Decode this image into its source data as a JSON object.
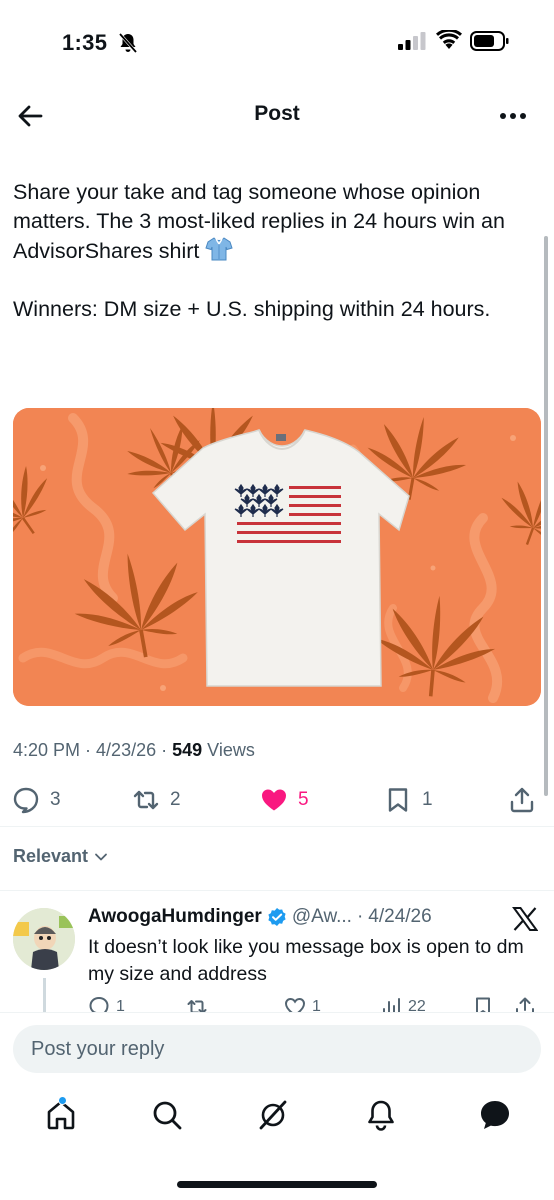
{
  "status_bar": {
    "time": "1:35"
  },
  "header": {
    "title": "Post"
  },
  "tweet": {
    "line1": "Share your take and tag someone whose opinion matters. The 3 most-liked replies in 24 hours win an AdvisorShares shirt",
    "line2": "Winners: DM size + U.S. shipping within 24 hours.",
    "time": "4:20 PM",
    "date": "4/23/26",
    "views_count": "549",
    "views_label": "Views",
    "replies": "3",
    "reposts": "2",
    "likes": "5",
    "bookmarks": "1"
  },
  "sort": {
    "label": "Relevant"
  },
  "reply": {
    "name": "AwoogaHumdinger",
    "handle": "@Aw...",
    "date": "4/24/26",
    "text": "It doesn’t look like you message box is open to dm my size and address",
    "replies": "1",
    "reposts": "",
    "likes": "1",
    "views": "22"
  },
  "composer": {
    "placeholder": "Post your reply"
  },
  "colors": {
    "like": "#f91880",
    "verified": "#1d9bf0",
    "image_bg": "#f28553"
  },
  "icons": {
    "back": "arrow-left-icon",
    "more": "ellipsis-icon",
    "reply": "speech-bubble-icon",
    "repost": "repost-icon",
    "like": "heart-icon",
    "bookmark": "bookmark-icon",
    "share": "share-icon",
    "home": "home-icon",
    "search": "search-icon",
    "grok": "grok-icon",
    "notifications": "bell-icon",
    "messages": "message-icon"
  }
}
